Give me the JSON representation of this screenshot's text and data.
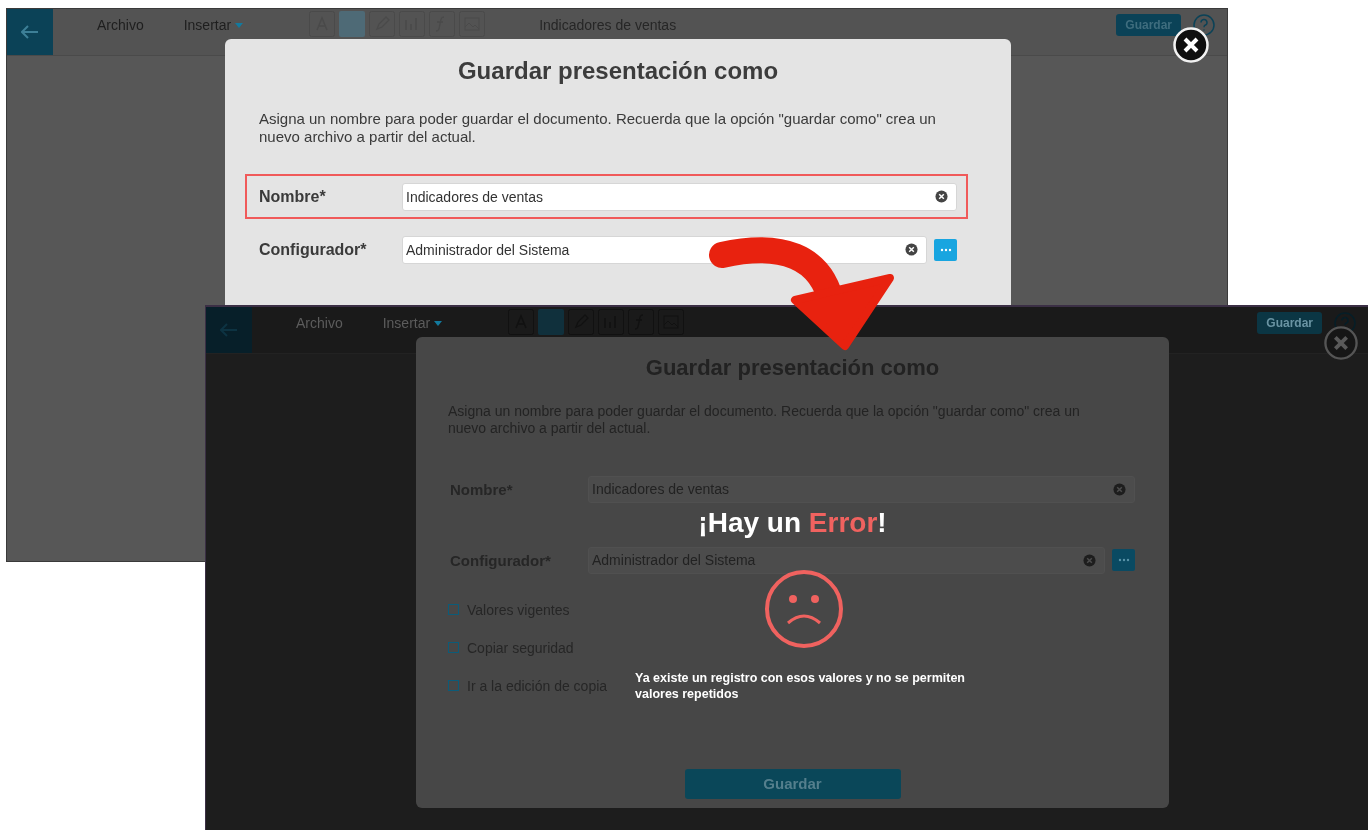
{
  "screens": [
    {
      "kind": "normal",
      "toolbar": {
        "menus": [
          {
            "label": "Archivo",
            "has_caret": false
          },
          {
            "label": "Insertar",
            "has_caret": true
          }
        ],
        "document_title": "Indicadores de ventas",
        "save_button": "Guardar"
      },
      "dialog": {
        "title": "Guardar presentación como",
        "description": "Asigna un nombre para poder guardar el documento. Recuerda que la opción \"guardar como\" crea un nuevo archivo a partir del actual.",
        "fields": [
          {
            "label": "Nombre*",
            "value": "Indicadores de ventas",
            "highlighted": true,
            "has_lookup": false
          },
          {
            "label": "Configurador*",
            "value": "Administrador del Sistema",
            "highlighted": false,
            "has_lookup": true
          }
        ]
      }
    },
    {
      "kind": "error",
      "toolbar": {
        "menus": [
          {
            "label": "Archivo",
            "has_caret": false
          },
          {
            "label": "Insertar",
            "has_caret": true
          }
        ],
        "save_button": "Guardar"
      },
      "dialog": {
        "title": "Guardar presentación como",
        "description": "Asigna un nombre para poder guardar el documento. Recuerda que la opción \"guardar como\" crea un nuevo archivo a partir del actual.",
        "fields": [
          {
            "label": "Nombre*",
            "value": "Indicadores de ventas",
            "highlighted": false,
            "has_lookup": false
          },
          {
            "label": "Configurador*",
            "value": "Administrador del Sistema",
            "highlighted": false,
            "has_lookup": true
          }
        ],
        "options": [
          {
            "label": "Valores vigentes",
            "checked": false
          },
          {
            "label": "Copiar seguridad",
            "checked": false
          },
          {
            "label": "Ir a la edición de copia",
            "checked": false
          }
        ],
        "submit_button": "Guardar",
        "error": {
          "title_parts": [
            "¡Hay un ",
            "Error",
            "!"
          ],
          "message": "Ya existe un registro con esos valores y no se permiten valores repetidos"
        }
      }
    }
  ]
}
